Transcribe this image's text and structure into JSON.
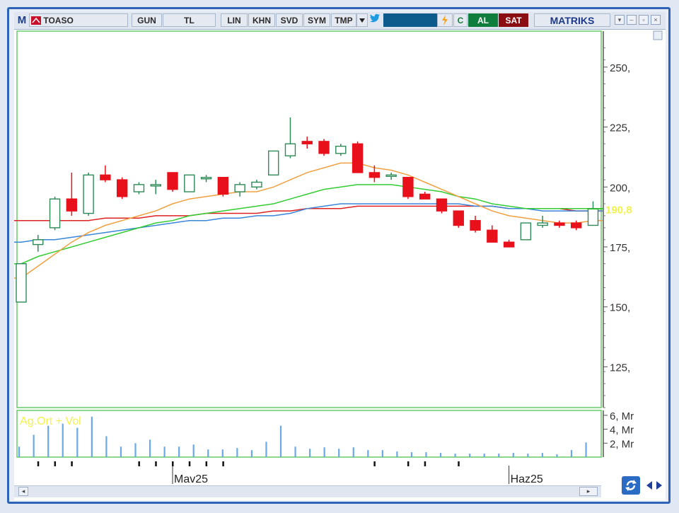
{
  "toolbar": {
    "logo": "M",
    "symbol": "TOASO",
    "buttons": [
      "GUN",
      "TL",
      "LIN",
      "KHN",
      "SVD",
      "SYM",
      "TMP"
    ],
    "buy_label": "AL",
    "sell_label": "SAT",
    "brand": "MATRIKS",
    "c_label": "C"
  },
  "colors": {
    "up_candle": "#2e8b57",
    "down_candle": "#e8101a",
    "ma_orange": "#f0a040",
    "ma_green": "#33cc33",
    "ma_blue": "#3a86d8",
    "ma_red": "#dd2222",
    "volume": "#6aa8e8",
    "grid_border": "#66cc66",
    "last_price_label": "#f2f24a"
  },
  "chart_data": {
    "type": "candlestick",
    "symbol": "TOASO",
    "y_ticks": [
      "250,",
      "225,",
      "200,",
      "175,",
      "150,",
      "125,"
    ],
    "y_range": [
      108,
      265
    ],
    "last_price": "190,8",
    "x_labels": [
      "Mav25",
      "Haz25"
    ],
    "candles": [
      {
        "o": 152,
        "h": 168,
        "l": 152,
        "c": 168
      },
      {
        "o": 176,
        "h": 180,
        "l": 173,
        "c": 178
      },
      {
        "o": 183,
        "h": 196,
        "l": 182,
        "c": 195
      },
      {
        "o": 195,
        "h": 206,
        "l": 188,
        "c": 190
      },
      {
        "o": 189,
        "h": 206,
        "l": 188,
        "c": 205
      },
      {
        "o": 205,
        "h": 209,
        "l": 202,
        "c": 203
      },
      {
        "o": 203,
        "h": 204,
        "l": 195,
        "c": 196
      },
      {
        "o": 198,
        "h": 202,
        "l": 197,
        "c": 201
      },
      {
        "o": 201,
        "h": 203,
        "l": 197,
        "c": 201
      },
      {
        "o": 206,
        "h": 206,
        "l": 198,
        "c": 199
      },
      {
        "o": 198,
        "h": 205,
        "l": 198,
        "c": 205
      },
      {
        "o": 204,
        "h": 205,
        "l": 202,
        "c": 204
      },
      {
        "o": 204,
        "h": 204,
        "l": 196,
        "c": 197
      },
      {
        "o": 198,
        "h": 202,
        "l": 196,
        "c": 201
      },
      {
        "o": 200,
        "h": 203,
        "l": 199,
        "c": 202
      },
      {
        "o": 205,
        "h": 215,
        "l": 205,
        "c": 215
      },
      {
        "o": 213,
        "h": 229,
        "l": 212,
        "c": 218
      },
      {
        "o": 219,
        "h": 221,
        "l": 216,
        "c": 218
      },
      {
        "o": 219,
        "h": 220,
        "l": 213,
        "c": 214
      },
      {
        "o": 214,
        "h": 218,
        "l": 213,
        "c": 217
      },
      {
        "o": 218,
        "h": 219,
        "l": 206,
        "c": 206
      },
      {
        "o": 206,
        "h": 209,
        "l": 202,
        "c": 204
      },
      {
        "o": 205,
        "h": 206,
        "l": 203,
        "c": 205
      },
      {
        "o": 204,
        "h": 204,
        "l": 195,
        "c": 196
      },
      {
        "o": 197,
        "h": 198,
        "l": 195,
        "c": 195
      },
      {
        "o": 195,
        "h": 195,
        "l": 189,
        "c": 190
      },
      {
        "o": 190,
        "h": 190,
        "l": 183,
        "c": 184
      },
      {
        "o": 186,
        "h": 188,
        "l": 181,
        "c": 182
      },
      {
        "o": 182,
        "h": 184,
        "l": 177,
        "c": 177
      },
      {
        "o": 177,
        "h": 178,
        "l": 175,
        "c": 175
      },
      {
        "o": 178,
        "h": 185,
        "l": 178,
        "c": 185
      },
      {
        "o": 184,
        "h": 188,
        "l": 183,
        "c": 185
      },
      {
        "o": 185,
        "h": 186,
        "l": 183,
        "c": 184
      },
      {
        "o": 185,
        "h": 186,
        "l": 182,
        "c": 183
      },
      {
        "o": 184,
        "h": 194,
        "l": 184,
        "c": 191
      }
    ],
    "ma_orange": [
      162,
      167,
      172,
      177,
      181,
      184,
      186,
      188,
      190,
      193,
      195,
      196,
      197,
      198,
      198,
      200,
      203,
      206,
      208,
      210,
      210,
      208,
      207,
      205,
      202,
      199,
      196,
      193,
      190,
      188,
      187,
      186,
      185,
      185,
      186
    ],
    "ma_green": [
      168,
      171,
      173,
      175,
      177,
      179,
      181,
      183,
      185,
      186,
      188,
      189,
      190,
      191,
      192,
      193,
      195,
      197,
      199,
      200,
      201,
      201,
      201,
      200,
      199,
      198,
      196,
      195,
      193,
      192,
      191,
      191,
      191,
      191,
      191
    ],
    "ma_blue": [
      177,
      178,
      178,
      179,
      180,
      181,
      182,
      183,
      184,
      185,
      186,
      186,
      187,
      187,
      188,
      188,
      189,
      191,
      192,
      193,
      193,
      193,
      193,
      193,
      193,
      193,
      193,
      192,
      192,
      191,
      191,
      190,
      190,
      190,
      190
    ],
    "ma_red": [
      186,
      186,
      186,
      186,
      186,
      187,
      187,
      187,
      188,
      188,
      188,
      189,
      189,
      189,
      189,
      190,
      190,
      191,
      191,
      191,
      192,
      192,
      192,
      192,
      192,
      192,
      192,
      192,
      192,
      191,
      191,
      191,
      191,
      190,
      190
    ],
    "volume_panel": {
      "label": "Ag.Ort + Vol",
      "y_ticks": [
        "6, Mr",
        "4, Mr",
        "2, Mr"
      ],
      "y_range": [
        0,
        6.5
      ],
      "values": [
        1.5,
        3.2,
        4.5,
        4.8,
        4.2,
        5.8,
        3.0,
        1.5,
        2.0,
        2.5,
        1.5,
        1.5,
        1.8,
        1.1,
        1.1,
        1.3,
        1.0,
        2.2,
        4.5,
        1.5,
        1.2,
        1.4,
        1.2,
        1.4,
        1.0,
        1.0,
        0.8,
        0.7,
        0.7,
        0.6,
        0.5,
        0.5,
        0.5,
        0.5,
        0.6,
        0.5,
        0.6,
        0.4,
        1.0,
        2.1
      ]
    }
  }
}
